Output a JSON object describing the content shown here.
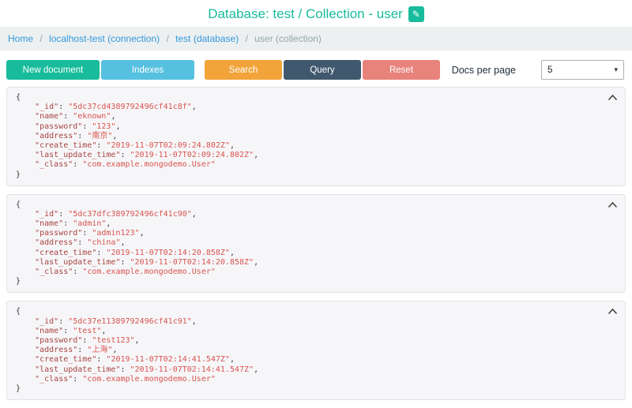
{
  "header": {
    "title": "Database: test / Collection - user",
    "edit_icon": "pencil-icon"
  },
  "breadcrumb": {
    "separator": "/",
    "items": [
      {
        "label": "Home",
        "link": true
      },
      {
        "label": "localhost-test (connection)",
        "link": true
      },
      {
        "label": "test (database)",
        "link": true
      },
      {
        "label": "user (collection)",
        "link": false
      }
    ]
  },
  "toolbar": {
    "new_document": "New document",
    "indexes": "Indexes",
    "search": "Search",
    "query": "Query",
    "reset": "Reset",
    "docs_per_page_label": "Docs per page",
    "docs_per_page_value": "5"
  },
  "colors": {
    "accent_teal": "#18bc9c",
    "indexes_blue": "#56c0e0",
    "search_orange": "#f2a43a",
    "query_dark": "#41596e",
    "reset_red": "#e8837b",
    "breadcrumb_bg": "#ecf0f1",
    "link_blue": "#3498db",
    "json_key": "#a94442",
    "json_value": "#d9534f"
  },
  "documents": [
    {
      "fields": [
        [
          "_id",
          "5dc37cd4389792496cf41c8f"
        ],
        [
          "name",
          "eknown"
        ],
        [
          "password",
          "123"
        ],
        [
          "address",
          "南京"
        ],
        [
          "create_time",
          "2019-11-07T02:09:24.802Z"
        ],
        [
          "last_update_time",
          "2019-11-07T02:09:24.802Z"
        ],
        [
          "_class",
          "com.example.mongodemo.User"
        ]
      ]
    },
    {
      "fields": [
        [
          "_id",
          "5dc37dfc389792496cf41c90"
        ],
        [
          "name",
          "admin"
        ],
        [
          "password",
          "admin123"
        ],
        [
          "address",
          "china"
        ],
        [
          "create_time",
          "2019-11-07T02:14:20.858Z"
        ],
        [
          "last_update_time",
          "2019-11-07T02:14:20.858Z"
        ],
        [
          "_class",
          "com.example.mongodemo.User"
        ]
      ]
    },
    {
      "fields": [
        [
          "_id",
          "5dc37e11389792496cf41c91"
        ],
        [
          "name",
          "test"
        ],
        [
          "password",
          "test123"
        ],
        [
          "address",
          "上海"
        ],
        [
          "create_time",
          "2019-11-07T02:14:41.547Z"
        ],
        [
          "last_update_time",
          "2019-11-07T02:14:41.547Z"
        ],
        [
          "_class",
          "com.example.mongodemo.User"
        ]
      ]
    }
  ]
}
